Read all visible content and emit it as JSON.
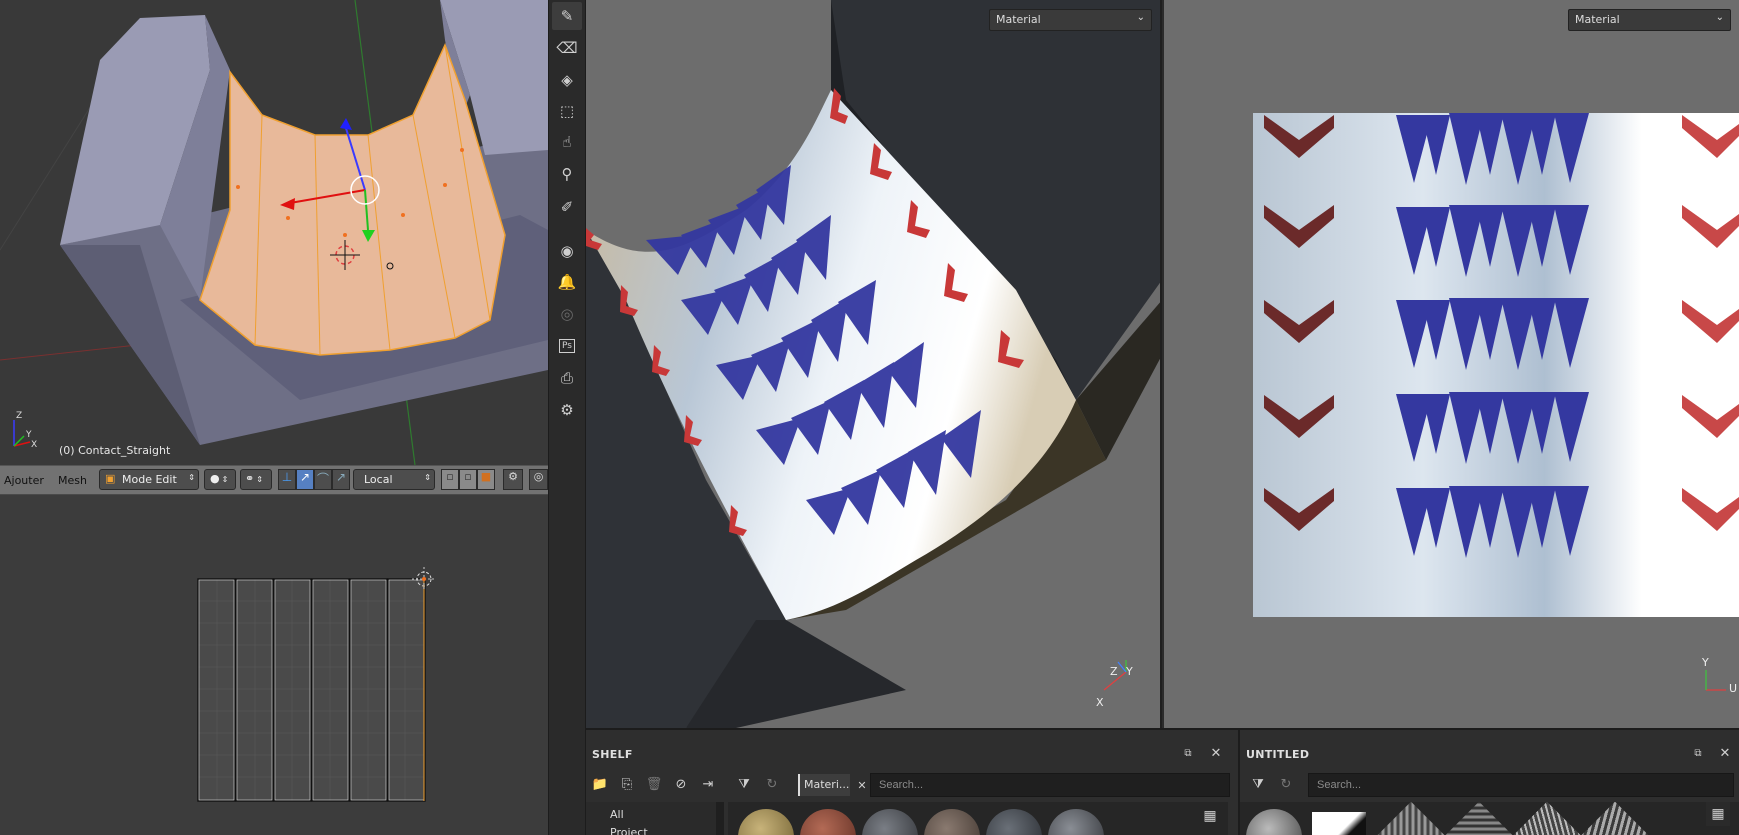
{
  "blender": {
    "object_label": "(0) Contact_Straight",
    "header": {
      "menu_ajouter": "Ajouter",
      "menu_mesh": "Mesh",
      "mode_label": "Mode Edit",
      "orientation_label": "Local"
    },
    "axis": {
      "x": "X",
      "y": "Y",
      "z": "Z"
    }
  },
  "painter": {
    "viewport3d": {
      "material_dropdown": "Material",
      "axis_labels": {
        "x": "X",
        "y": "Y",
        "z": "Z"
      }
    },
    "viewport2d": {
      "material_dropdown": "Material",
      "axis_labels": {
        "u": "U",
        "v": "Y"
      }
    },
    "toolbar": {
      "tools": [
        "paint-brush-icon",
        "eraser-icon",
        "projection-icon",
        "polygon-fill-icon",
        "smudge-icon",
        "clone-icon",
        "color-picker-icon",
        "bake-icon",
        "notification-icon",
        "substance-icon",
        "photoshop-icon",
        "render-icon",
        "settings-icon"
      ],
      "ps_label": "Ps"
    },
    "shelf": {
      "title": "SHELF",
      "filter_tag": "Materi...",
      "search_placeholder": "Search...",
      "categories": [
        "All",
        "Project"
      ]
    },
    "untitled": {
      "title": "UNTITLED",
      "search_placeholder": "Search..."
    },
    "colors": {
      "accent_orange": "#f0a030",
      "chevron_red": "#6b2a2a",
      "arrow_blue": "#3a3aa0",
      "metal_light": "#dfe6ef"
    }
  }
}
